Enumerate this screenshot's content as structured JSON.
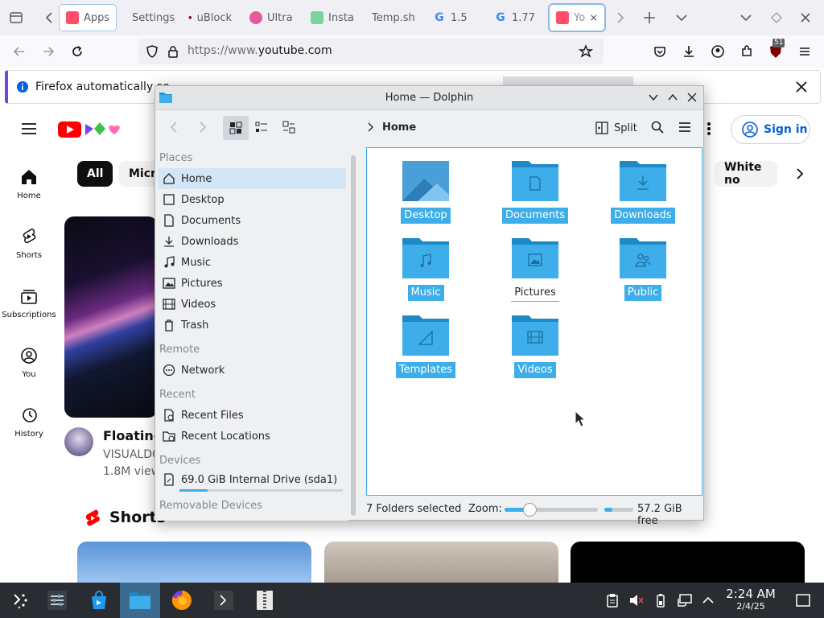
{
  "browser": {
    "tabs": [
      {
        "label": "Apps",
        "fav": "#ff4e6a"
      },
      {
        "label": "Settings",
        "fav": "gear"
      },
      {
        "label": "uBlock",
        "fav": "#800000"
      },
      {
        "label": "Ultra",
        "fav": "#e35b9a"
      },
      {
        "label": "Insta",
        "fav": "#7ad4a0"
      },
      {
        "label": "Temp.sh",
        "fav": "none"
      },
      {
        "label": "1.5",
        "fav": "google"
      },
      {
        "label": "1.77",
        "fav": "google"
      },
      {
        "label": "YouTube",
        "fav": "#ff4e6a"
      }
    ],
    "url_protocol": "https://www.",
    "url_domain": "youtube.com",
    "ublock_badge": "51",
    "notification": "Firefox automatically se"
  },
  "youtube": {
    "sidebar": [
      "Home",
      "Shorts",
      "Subscriptions",
      "You",
      "History"
    ],
    "chips": [
      "All",
      "Micro",
      "White no"
    ],
    "sign_in": "Sign in",
    "video_title": "Floating",
    "channel": "VISUALDC",
    "views": "1.8M view",
    "shorts_heading": "Shorts"
  },
  "dolphin": {
    "title": "Home — Dolphin",
    "breadcrumb": "Home",
    "split_label": "Split",
    "places_sections": {
      "places": "Places",
      "remote": "Remote",
      "recent": "Recent",
      "devices": "Devices",
      "removable": "Removable Devices"
    },
    "places": [
      "Home",
      "Desktop",
      "Documents",
      "Downloads",
      "Music",
      "Pictures",
      "Videos",
      "Trash"
    ],
    "remote": [
      "Network"
    ],
    "recent": [
      "Recent Files",
      "Recent Locations"
    ],
    "device": "69.0 GiB Internal Drive (sda1)",
    "device_used": 0.17,
    "folders": [
      {
        "name": "Desktop",
        "selected": true
      },
      {
        "name": "Documents",
        "selected": true
      },
      {
        "name": "Downloads",
        "selected": true
      },
      {
        "name": "Music",
        "selected": true
      },
      {
        "name": "Pictures",
        "selected": false
      },
      {
        "name": "Public",
        "selected": true
      },
      {
        "name": "Templates",
        "selected": true
      },
      {
        "name": "Videos",
        "selected": true
      }
    ],
    "status_selected": "7 Folders selected",
    "zoom_label": "Zoom:",
    "zoom_level": 0.27,
    "free_space": "57.2 GiB free"
  },
  "taskbar": {
    "time": "2:24 AM",
    "date": "2/4/25"
  },
  "colors": {
    "accent": "#3daee9",
    "folder": "#3daee9",
    "yt_red": "#ff0000"
  }
}
